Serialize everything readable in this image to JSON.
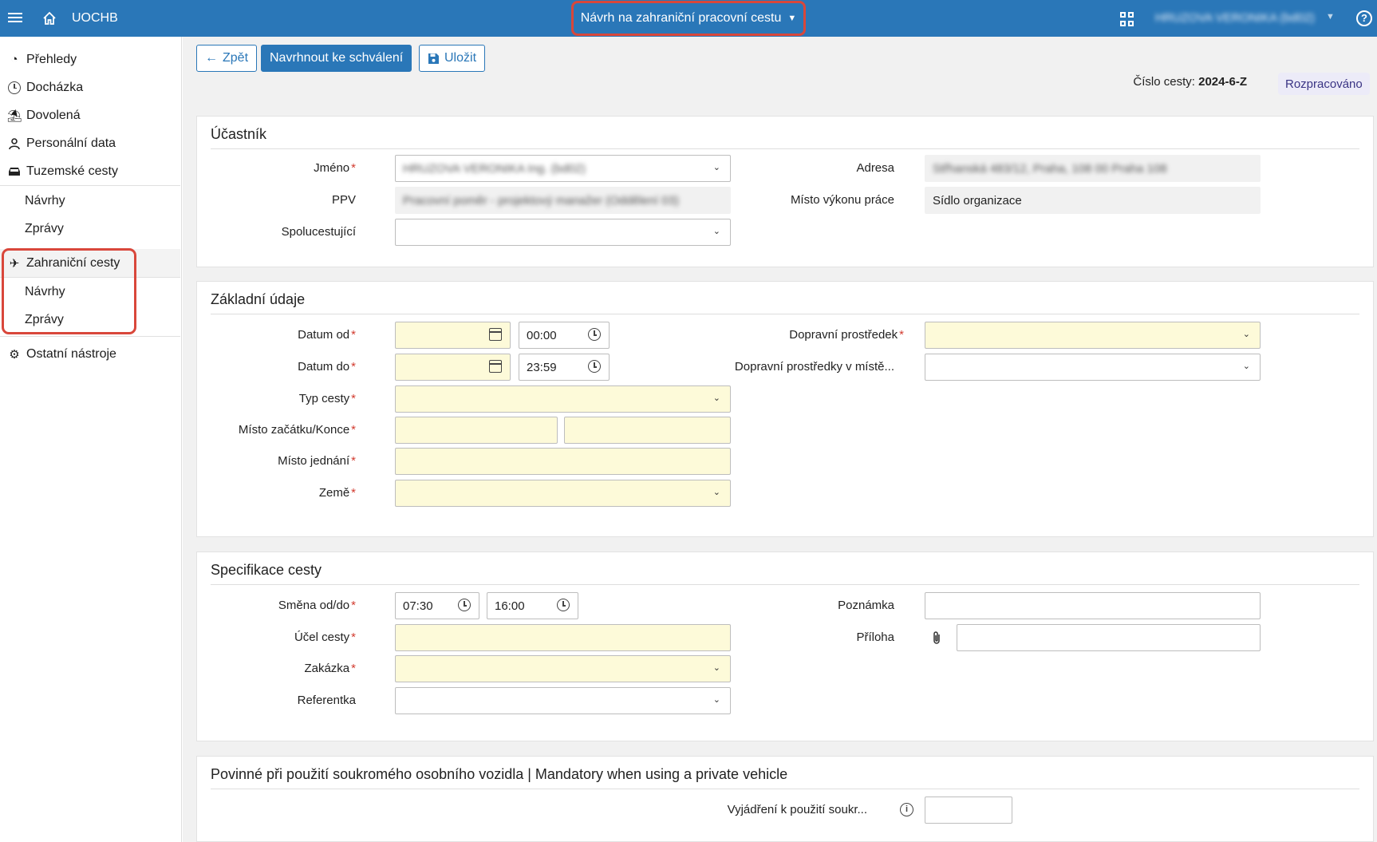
{
  "topbar": {
    "app_name": "UOCHB",
    "page_title": "Návrh na zahraniční pracovní cestu",
    "user_name": "HRUZOVA VERONIKA (bd02)"
  },
  "sidebar": {
    "items": [
      {
        "label": "Přehledy",
        "icon": "chart-icon"
      },
      {
        "label": "Docházka",
        "icon": "clock-icon"
      },
      {
        "label": "Dovolená",
        "icon": "beach-icon"
      },
      {
        "label": "Personální data",
        "icon": "person-icon"
      },
      {
        "label": "Tuzemské cesty",
        "icon": "car-icon"
      },
      {
        "label": "Zahraniční cesty",
        "icon": "plane-icon"
      },
      {
        "label": "Ostatní nástroje",
        "icon": "gear-icon"
      }
    ],
    "domestic_sub": [
      "Návrhy",
      "Zprávy"
    ],
    "foreign_sub": [
      "Návrhy",
      "Zprávy"
    ]
  },
  "toolbar": {
    "back_label": "Zpět",
    "submit_label": "Navrhnout ke schválení",
    "save_label": "Uložit",
    "trip_number_label": "Číslo cesty:",
    "trip_number": "2024-6-Z",
    "status": "Rozpracováno"
  },
  "participant": {
    "title": "Účastník",
    "name_label": "Jméno",
    "name_value": "HRUZOVA VERONIKA Ing. (bd02)",
    "ppv_label": "PPV",
    "ppv_value": "Pracovní poměr - projektový manažer (Oddělení 03)",
    "companions_label": "Spolucestující",
    "address_label": "Adresa",
    "address_value": "Střhanská 483/12, Praha, 108 00 Praha 108",
    "workplace_label": "Místo výkonu práce",
    "workplace_value": "Sídlo organizace"
  },
  "basic": {
    "title": "Základní údaje",
    "date_from_label": "Datum od",
    "time_from": "00:00",
    "date_to_label": "Datum do",
    "time_to": "23:59",
    "trip_type_label": "Typ cesty",
    "start_end_label": "Místo začátku/Konce",
    "meeting_place_label": "Místo jednání",
    "country_label": "Země",
    "transport_label": "Dopravní prostředek",
    "local_transport_label": "Dopravní prostředky v místě..."
  },
  "spec": {
    "title": "Specifikace cesty",
    "shift_label": "Směna od/do",
    "shift_from": "07:30",
    "shift_to": "16:00",
    "purpose_label": "Účel cesty",
    "order_label": "Zakázka",
    "referent_label": "Referentka",
    "note_label": "Poznámka",
    "attachment_label": "Příloha"
  },
  "vehicle": {
    "title": "Povinné při použití soukromého osobního vozidla | Mandatory when using a private vehicle",
    "statement_label": "Vyjádření k použití soukr..."
  },
  "colors": {
    "accent": "#2a77b8",
    "required_field": "#fdfad9",
    "highlight": "#d9473b",
    "status_bg": "#ecebf8"
  }
}
